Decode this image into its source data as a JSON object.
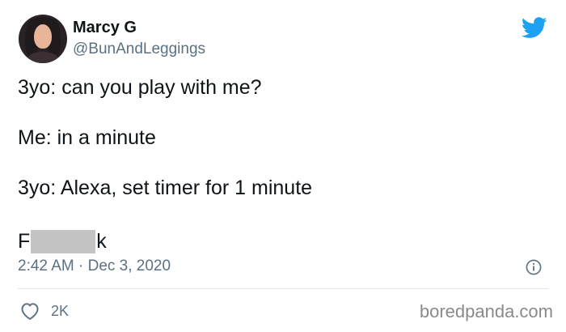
{
  "author": {
    "display_name": "Marcy G",
    "handle": "@BunAndLeggings"
  },
  "tweet": {
    "lines": [
      "3yo: can you play with me?",
      "Me: in a minute",
      "3yo: Alexa, set timer for 1 minute"
    ],
    "censored_word": {
      "first_letter": "F",
      "last_letter": "k"
    },
    "timestamp": "2:42 AM · Dec 3, 2020"
  },
  "actions": {
    "likes": "2K"
  },
  "watermark": "boredpanda.com",
  "icons": {
    "platform": "twitter-bird-icon",
    "info": "info-icon",
    "like": "heart-icon"
  },
  "colors": {
    "twitter_blue": "#1da1f2",
    "secondary_text": "#5b7083",
    "censor_gray": "#c4c4c4"
  }
}
